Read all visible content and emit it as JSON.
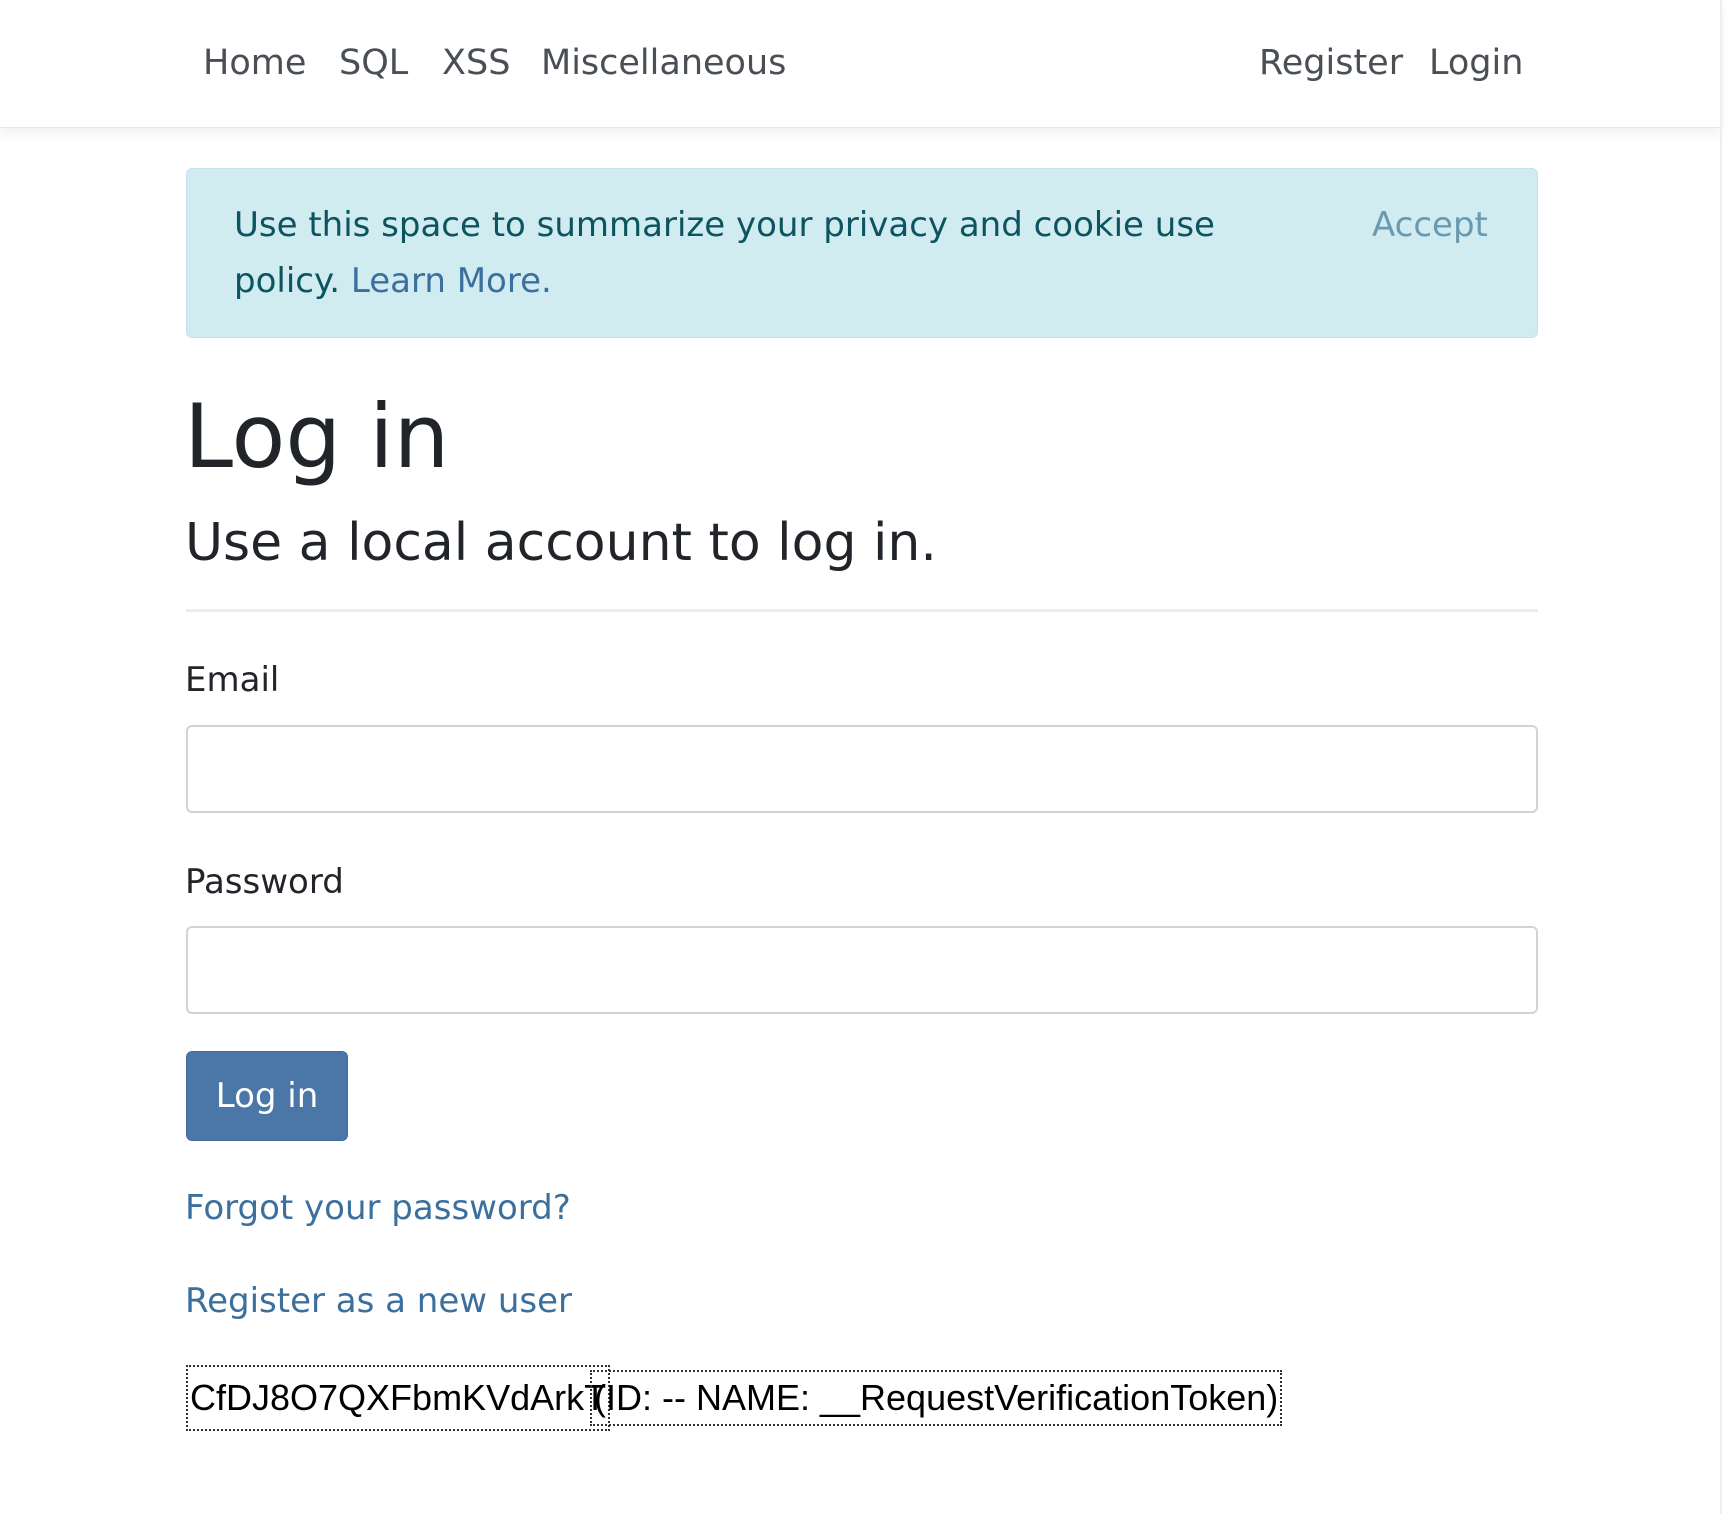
{
  "navbar": {
    "left_links": [
      "Home",
      "SQL",
      "XSS",
      "Miscellaneous"
    ],
    "right_links": [
      "Register",
      "Login"
    ]
  },
  "cookie_banner": {
    "text": "Use this space to summarize your privacy and cookie use policy.",
    "learn_more": "Learn More.",
    "accept": "Accept"
  },
  "login": {
    "title": "Log in",
    "subtitle": "Use a local account to log in.",
    "email_label": "Email",
    "email_value": "",
    "password_label": "Password",
    "password_value": "",
    "submit_label": "Log in",
    "forgot_password": "Forgot your password?",
    "register_link": "Register as a new user"
  },
  "token_overlay": {
    "value": "CfDJ8O7QXFbmKVdArkT",
    "meta": "(ID: -- NAME: __RequestVerificationToken)"
  },
  "colors": {
    "banner_bg": "#d1ecf1",
    "link": "#3b6f9d",
    "button_bg": "#4a76a8"
  }
}
